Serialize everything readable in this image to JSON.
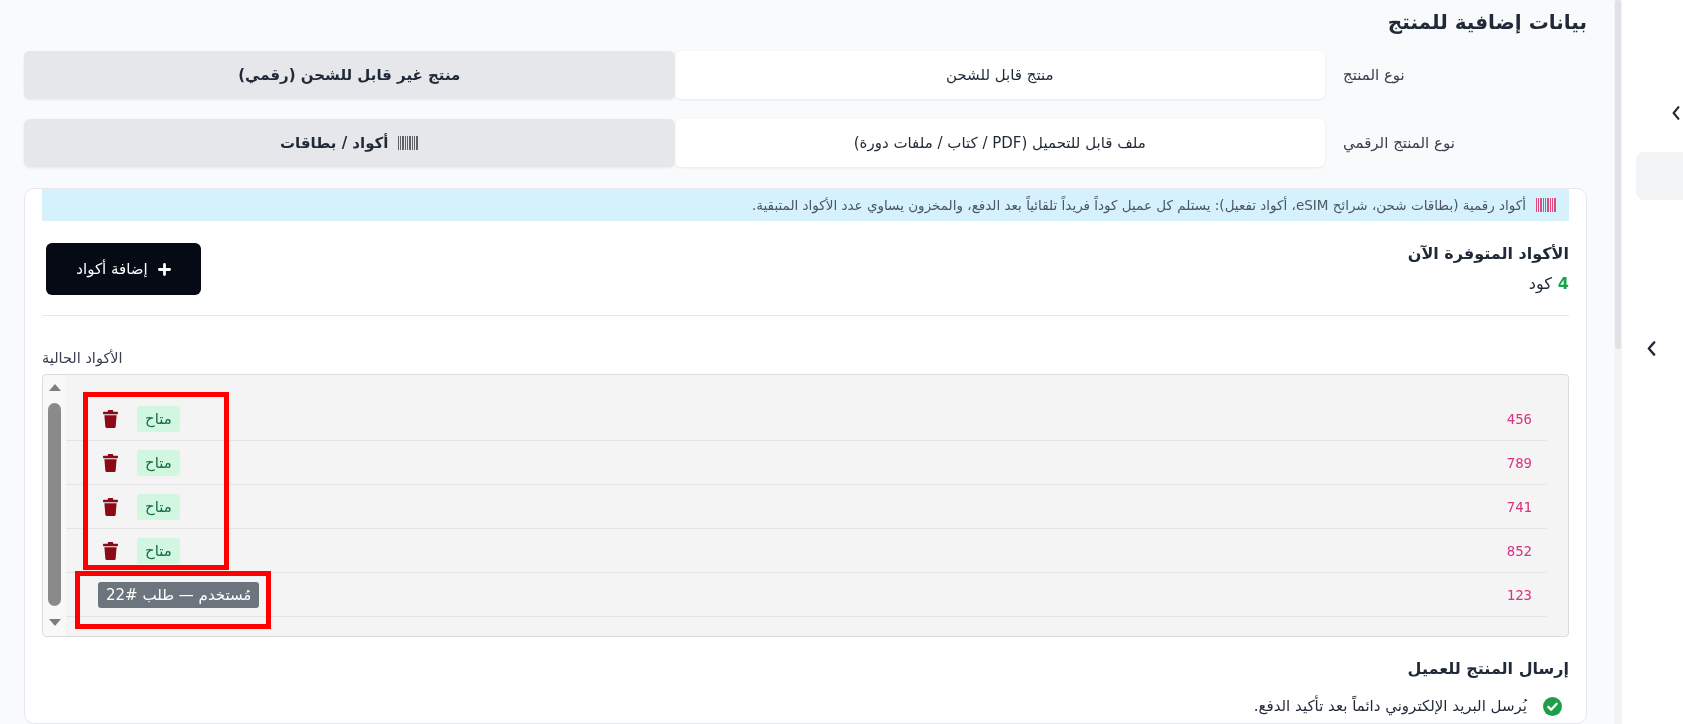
{
  "section": {
    "title": "بيانات إضافية للمنتج"
  },
  "fields": [
    {
      "label": "نوع المنتج",
      "options": [
        {
          "label": "منتج قابل للشحن",
          "selected": false
        },
        {
          "label": "منتج غير قابل للشحن (رقمي)",
          "selected": true
        }
      ]
    },
    {
      "label": "نوع المنتج الرقمي",
      "options": [
        {
          "label": "ملف قابل للتحميل (PDF / كتاب / ملفات دورة)",
          "selected": false,
          "kind": "file"
        },
        {
          "label": "أكواد / بطاقات",
          "selected": true,
          "kind": "codes"
        }
      ]
    }
  ],
  "notice": {
    "text": "أكواد رقمية (بطاقات شحن، شرائح eSIM، أكواد تفعيل): يستلم كل عميل كوداً فريداً تلقائياً بعد الدفع، والمخزون يساوي عدد الأكواد المتبقية."
  },
  "available": {
    "title": "الأكواد المتوفرة الآن",
    "count": "4",
    "unit": "كود"
  },
  "add_button": {
    "label": "إضافة أكواد"
  },
  "codes_list": {
    "label": "الأكواد الحالية",
    "highlighted": true,
    "codes": [
      {
        "code": "456",
        "status": "متاح",
        "kind": "available"
      },
      {
        "code": "789",
        "status": "متاح",
        "kind": "available"
      },
      {
        "code": "741",
        "status": "متاح",
        "kind": "available"
      },
      {
        "code": "852",
        "status": "متاح",
        "kind": "available"
      },
      {
        "code": "123",
        "status": "مُستخدم — طلب #22",
        "kind": "used"
      }
    ]
  },
  "delivery": {
    "title": "إرسال المنتج للعميل",
    "items": [
      {
        "text": "يُرسل البريد الإلكتروني دائماً بعد تأكيد الدفع.",
        "checked": true
      }
    ]
  }
}
